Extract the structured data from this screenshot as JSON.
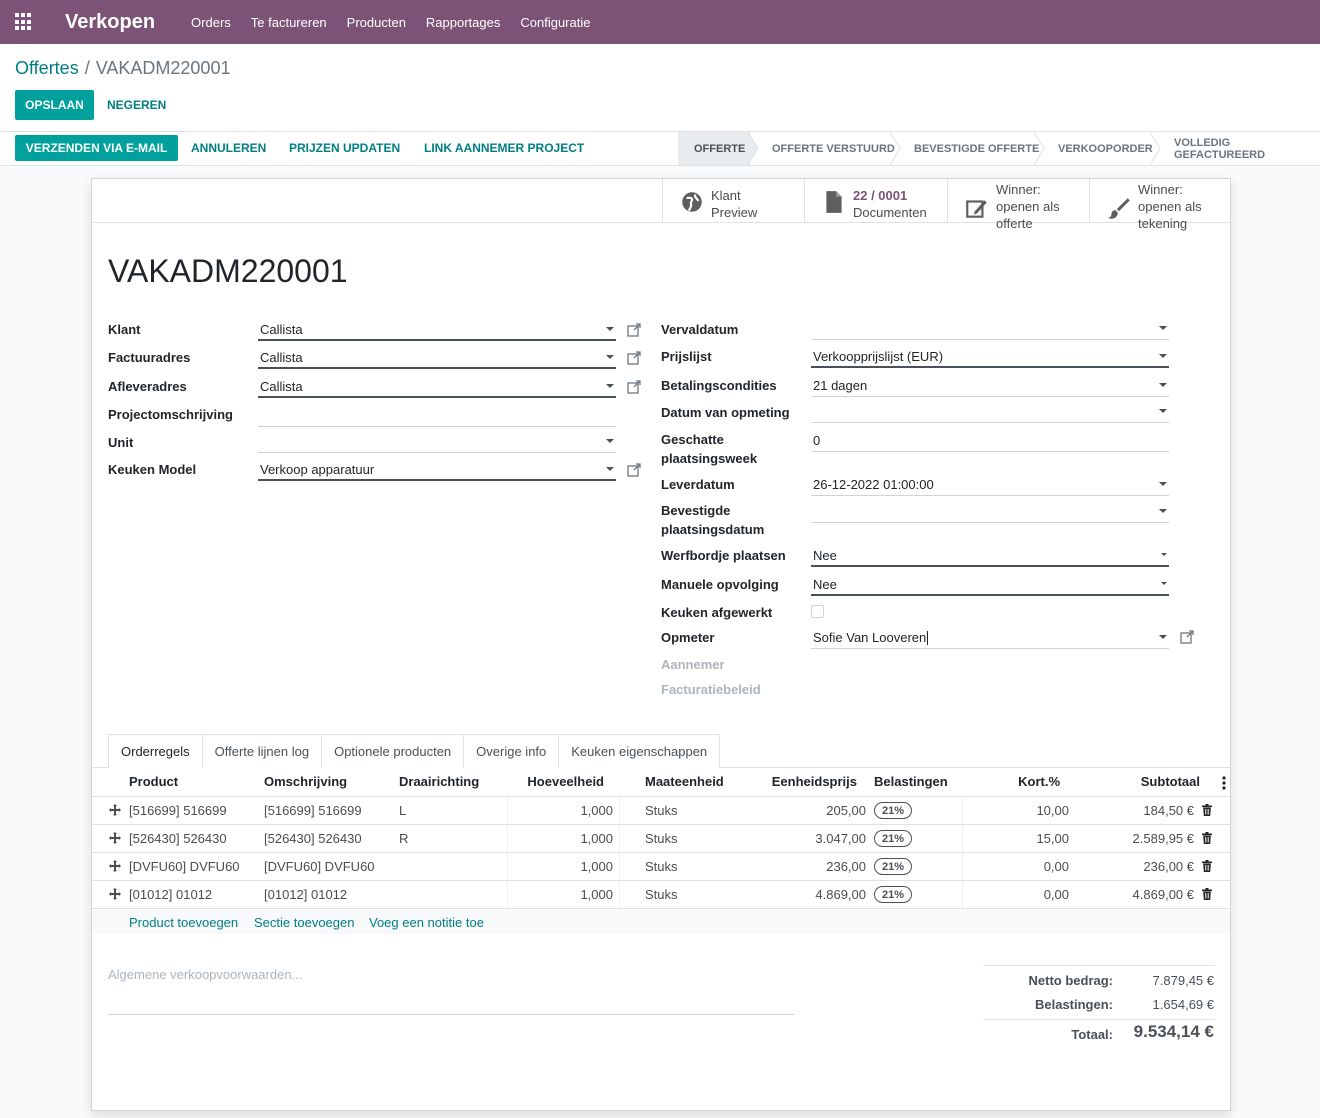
{
  "nav": {
    "brand": "Verkopen",
    "items": [
      "Orders",
      "Te factureren",
      "Producten",
      "Rapportages",
      "Configuratie"
    ]
  },
  "breadcrumb": {
    "parent": "Offertes",
    "separator": "/",
    "current": "VAKADM220001"
  },
  "buttons": {
    "save": "OPSLAAN",
    "discard": "NEGEREN"
  },
  "actions": {
    "send_email": "VERZENDEN VIA E-MAIL",
    "cancel": "ANNULEREN",
    "update_prices": "PRIJZEN UPDATEN",
    "link_contractor": "LINK AANNEMER PROJECT"
  },
  "stages": [
    "OFFERTE",
    "OFFERTE VERSTUURD",
    "BEVESTIGDE OFFERTE",
    "VERKOOPORDER",
    "VOLLEDIG GEFACTUREERD"
  ],
  "active_stage": "OFFERTE",
  "smart_buttons": {
    "preview": {
      "line1": "Klant",
      "line2": "Preview"
    },
    "documents": {
      "count": "22 / 0001",
      "label": "Documenten"
    },
    "winner_quote": {
      "line1": "Winner:",
      "line2": "openen als",
      "line3": "offerte"
    },
    "winner_drawing": {
      "line1": "Winner:",
      "line2": "openen als",
      "line3": "tekening"
    }
  },
  "record": {
    "name": "VAKADM220001"
  },
  "left_fields": {
    "klant": {
      "label": "Klant",
      "value": "Callista"
    },
    "factuuradres": {
      "label": "Factuuradres",
      "value": "Callista"
    },
    "afleveradres": {
      "label": "Afleveradres",
      "value": "Callista"
    },
    "projectomschrijving": {
      "label": "Projectomschrijving",
      "value": ""
    },
    "unit": {
      "label": "Unit",
      "value": ""
    },
    "keuken_model": {
      "label": "Keuken Model",
      "value": "Verkoop apparatuur"
    }
  },
  "right_fields": {
    "vervaldatum": {
      "label": "Vervaldatum",
      "value": ""
    },
    "prijslijst": {
      "label": "Prijslijst",
      "value": "Verkoopprijslijst (EUR)"
    },
    "betalingscondities": {
      "label": "Betalingscondities",
      "value": "21 dagen"
    },
    "datum_opmeting": {
      "label": "Datum van opmeting",
      "value": ""
    },
    "plaatsingsweek": {
      "label1": "Geschatte",
      "label2": "plaatsingsweek",
      "value": "0"
    },
    "leverdatum": {
      "label": "Leverdatum",
      "value": "26-12-2022 01:00:00"
    },
    "bevestigde": {
      "label1": "Bevestigde",
      "label2": "plaatsingsdatum",
      "value": ""
    },
    "werfbordje": {
      "label": "Werfbordje plaatsen",
      "value": "Nee"
    },
    "manuele": {
      "label": "Manuele opvolging",
      "value": "Nee"
    },
    "keuken_afgewerkt": {
      "label": "Keuken afgewerkt",
      "checked": false
    },
    "opmeter": {
      "label": "Opmeter",
      "value": "Sofie Van Looveren"
    },
    "aannemer": {
      "label": "Aannemer"
    },
    "facturatiebeleid": {
      "label": "Facturatiebeleid"
    }
  },
  "tabs": [
    "Orderregels",
    "Offerte lijnen log",
    "Optionele producten",
    "Overige info",
    "Keuken eigenschappen"
  ],
  "table": {
    "headers": [
      "Product",
      "Omschrijving",
      "Draairichting",
      "Hoeveelheid",
      "Maateenheid",
      "Eenheidsprijs",
      "Belastingen",
      "Kort.%",
      "Subtotaal"
    ],
    "rows": [
      {
        "product": "[516699] 516699",
        "omschrijving": "[516699] 516699",
        "draairichting": "L",
        "hoeveelheid": "1,000",
        "maateenheid": "Stuks",
        "eenheidsprijs": "205,00",
        "belasting": "21%",
        "korting": "10,00",
        "subtotaal": "184,50 €"
      },
      {
        "product": "[526430] 526430",
        "omschrijving": "[526430] 526430",
        "draairichting": "R",
        "hoeveelheid": "1,000",
        "maateenheid": "Stuks",
        "eenheidsprijs": "3.047,00",
        "belasting": "21%",
        "korting": "15,00",
        "subtotaal": "2.589,95 €"
      },
      {
        "product": "[DVFU60] DVFU60",
        "omschrijving": "[DVFU60] DVFU60",
        "draairichting": "",
        "hoeveelheid": "1,000",
        "maateenheid": "Stuks",
        "eenheidsprijs": "236,00",
        "belasting": "21%",
        "korting": "0,00",
        "subtotaal": "236,00 €"
      },
      {
        "product": "[01012] 01012",
        "omschrijving": "[01012] 01012",
        "draairichting": "",
        "hoeveelheid": "1,000",
        "maateenheid": "Stuks",
        "eenheidsprijs": "4.869,00",
        "belasting": "21%",
        "korting": "0,00",
        "subtotaal": "4.869,00 €"
      }
    ],
    "add_links": {
      "product": "Product toevoegen",
      "section": "Sectie toevoegen",
      "note": "Voeg een notitie toe"
    }
  },
  "note_placeholder": "Algemene verkoopvoorwaarden...",
  "totals": {
    "netto_label": "Netto bedrag:",
    "netto": "7.879,45 €",
    "tax_label": "Belastingen:",
    "tax": "1.654,69 €",
    "total_label": "Totaal:",
    "total": "9.534,14 €"
  },
  "colors": {
    "brand": "#7c5276",
    "primary": "#00a09d",
    "link": "#017e84"
  }
}
